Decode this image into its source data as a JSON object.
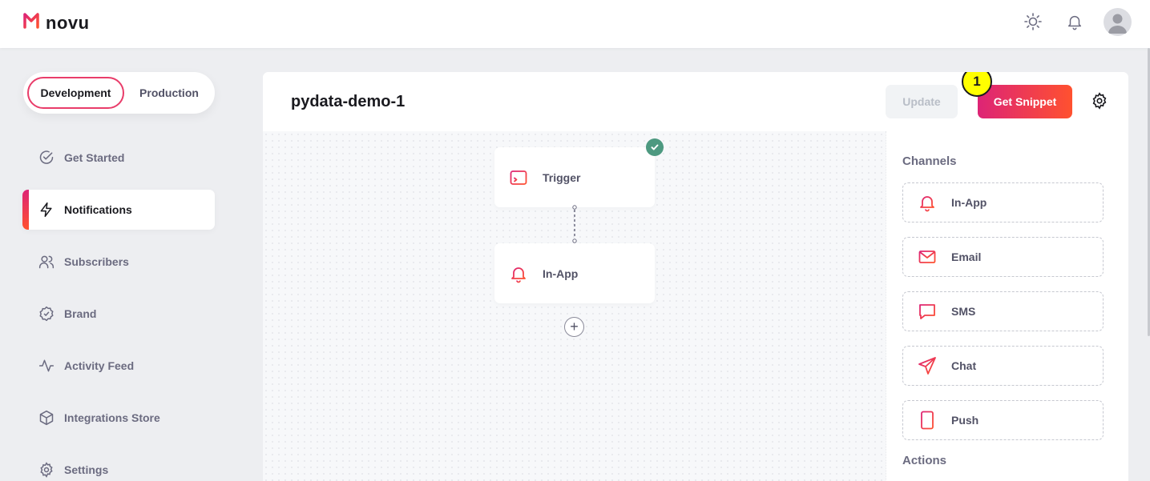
{
  "app": {
    "brand": "novu"
  },
  "environment": {
    "development_label": "Development",
    "production_label": "Production",
    "selected": "Development"
  },
  "nav": {
    "items": [
      {
        "label": "Get Started",
        "icon": "check-circle-icon"
      },
      {
        "label": "Notifications",
        "icon": "lightning-icon",
        "active": true
      },
      {
        "label": "Subscribers",
        "icon": "users-icon"
      },
      {
        "label": "Brand",
        "icon": "badge-check-icon"
      },
      {
        "label": "Activity Feed",
        "icon": "activity-icon"
      },
      {
        "label": "Integrations Store",
        "icon": "box-icon"
      },
      {
        "label": "Settings",
        "icon": "gear-icon"
      }
    ]
  },
  "workflow": {
    "title": "pydata-demo-1",
    "update_label": "Update",
    "snippet_label": "Get Snippet",
    "badge_number": "1",
    "nodes": [
      {
        "label": "Trigger",
        "icon": "terminal-icon",
        "checked": true
      },
      {
        "label": "In-App",
        "icon": "bell-icon"
      }
    ],
    "add_label": "+"
  },
  "side_panel": {
    "channels_title": "Channels",
    "channels": [
      {
        "label": "In-App",
        "icon": "bell-icon"
      },
      {
        "label": "Email",
        "icon": "mail-icon"
      },
      {
        "label": "SMS",
        "icon": "message-icon"
      },
      {
        "label": "Chat",
        "icon": "send-icon"
      },
      {
        "label": "Push",
        "icon": "mobile-icon"
      }
    ],
    "actions_title": "Actions"
  },
  "colors": {
    "accent_start": "#dd2476",
    "accent_end": "#ff512f",
    "success": "#4d9980",
    "badge": "#ffff00"
  }
}
